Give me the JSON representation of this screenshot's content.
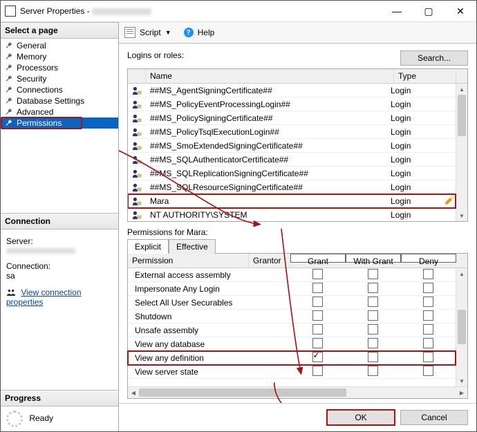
{
  "window": {
    "title": "Server Properties - "
  },
  "sysbuttons": {
    "min": "—",
    "max": "▢",
    "close": "✕"
  },
  "left": {
    "select_page": "Select a page",
    "pages": [
      "General",
      "Memory",
      "Processors",
      "Security",
      "Connections",
      "Database Settings",
      "Advanced",
      "Permissions"
    ],
    "selected_index": 7,
    "connection_head": "Connection",
    "server_label": "Server:",
    "connection_label": "Connection:",
    "connection_value": "sa",
    "view_conn_link": "View connection properties",
    "progress_head": "Progress",
    "progress_state": "Ready"
  },
  "toolbar": {
    "script": "Script",
    "help": "Help"
  },
  "main": {
    "logins_label": "Logins or roles:",
    "search_btn": "Search...",
    "col_name": "Name",
    "col_type": "Type",
    "logins": [
      {
        "name": "##MS_AgentSigningCertificate##",
        "type": "Login"
      },
      {
        "name": "##MS_PolicyEventProcessingLogin##",
        "type": "Login"
      },
      {
        "name": "##MS_PolicySigningCertificate##",
        "type": "Login"
      },
      {
        "name": "##MS_PolicyTsqlExecutionLogin##",
        "type": "Login"
      },
      {
        "name": "##MS_SmoExtendedSigningCertificate##",
        "type": "Login"
      },
      {
        "name": "##MS_SQLAuthenticatorCertificate##",
        "type": "Login"
      },
      {
        "name": "##MS_SQLReplicationSigningCertificate##",
        "type": "Login"
      },
      {
        "name": "##MS_SQLResourceSigningCertificate##",
        "type": "Login"
      },
      {
        "name": "Mara",
        "type": "Login",
        "selected": true
      },
      {
        "name": "NT AUTHORITY\\SYSTEM",
        "type": "Login"
      }
    ],
    "perm_for": "Permissions for Mara:",
    "tabs": [
      "Explicit",
      "Effective"
    ],
    "active_tab": 0,
    "perm_head": {
      "perm": "Permission",
      "grantor": "Grantor",
      "grant": "Grant",
      "withgrant": "With Grant",
      "deny": "Deny"
    },
    "permissions": [
      {
        "name": "External access assembly",
        "grant": false,
        "withgrant": false,
        "deny": false
      },
      {
        "name": "Impersonate Any Login",
        "grant": false,
        "withgrant": false,
        "deny": false
      },
      {
        "name": "Select All User Securables",
        "grant": false,
        "withgrant": false,
        "deny": false
      },
      {
        "name": "Shutdown",
        "grant": false,
        "withgrant": false,
        "deny": false
      },
      {
        "name": "Unsafe assembly",
        "grant": false,
        "withgrant": false,
        "deny": false
      },
      {
        "name": "View any database",
        "grant": false,
        "withgrant": false,
        "deny": false
      },
      {
        "name": "View any definition",
        "grant": true,
        "withgrant": false,
        "deny": false,
        "highlighted": true
      },
      {
        "name": "View server state",
        "grant": false,
        "withgrant": false,
        "deny": false
      }
    ]
  },
  "footer": {
    "ok": "OK",
    "cancel": "Cancel"
  }
}
